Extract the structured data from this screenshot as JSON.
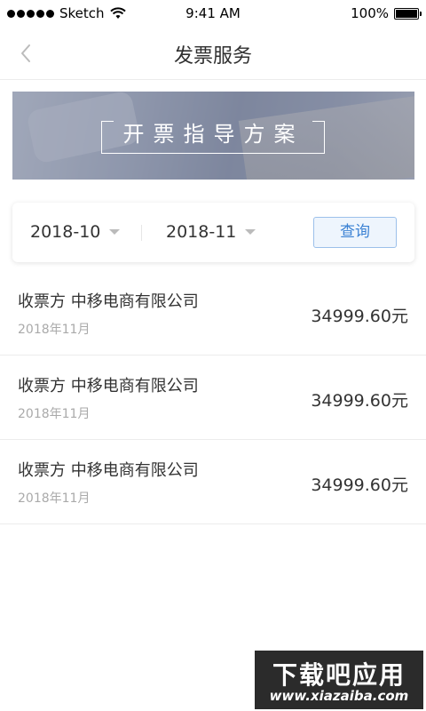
{
  "status_bar": {
    "carrier": "Sketch",
    "time": "9:41 AM",
    "battery": "100%"
  },
  "nav": {
    "title": "发票服务"
  },
  "banner": {
    "title": "开票指导方案"
  },
  "filter": {
    "start_date": "2018-10",
    "end_date": "2018-11",
    "query_label": "查询"
  },
  "invoices": [
    {
      "payee": "收票方 中移电商有限公司",
      "date": "2018年11月",
      "amount": "34999.60元"
    },
    {
      "payee": "收票方 中移电商有限公司",
      "date": "2018年11月",
      "amount": "34999.60元"
    },
    {
      "payee": "收票方 中移电商有限公司",
      "date": "2018年11月",
      "amount": "34999.60元"
    }
  ],
  "watermark": {
    "top": "下载吧应用",
    "bottom": "www.xiazaiba.com"
  }
}
